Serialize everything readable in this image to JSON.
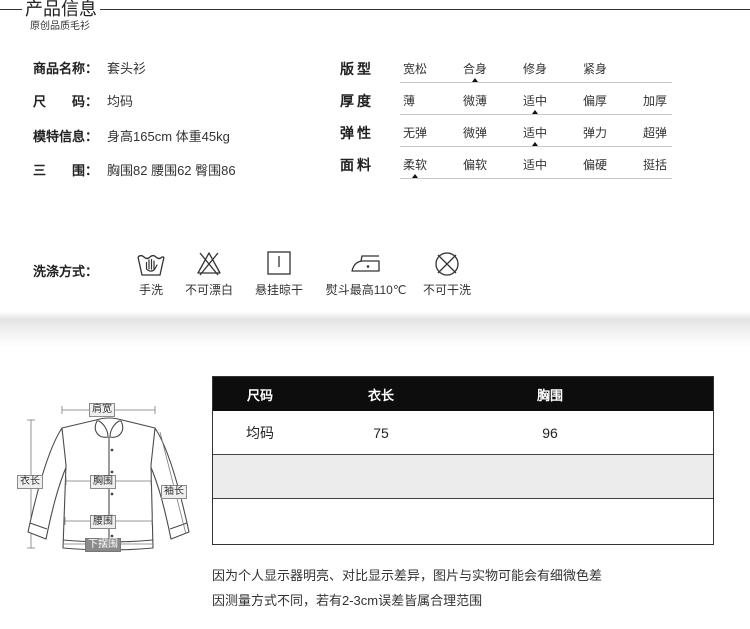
{
  "header": {
    "title": "产品信息",
    "subtitle": "原创品质毛衫"
  },
  "basic_info": [
    {
      "label": "商品名称：",
      "value": "套头衫"
    },
    {
      "label": "尺　　码：",
      "value": "均码"
    },
    {
      "label": "模特信息：",
      "value": "身高165cm 体重45kg"
    },
    {
      "label": "三　　围：",
      "value": "胸围82 腰围62 臀围86"
    }
  ],
  "specs": [
    {
      "label": "版型",
      "options": [
        "宽松",
        "合身",
        "修身",
        "紧身"
      ],
      "selected": 1
    },
    {
      "label": "厚度",
      "options": [
        "薄",
        "微薄",
        "适中",
        "偏厚",
        "加厚"
      ],
      "selected": 2
    },
    {
      "label": "弹性",
      "options": [
        "无弹",
        "微弹",
        "适中",
        "弹力",
        "超弹"
      ],
      "selected": 2
    },
    {
      "label": "面料",
      "options": [
        "柔软",
        "偏软",
        "适中",
        "偏硬",
        "挺括"
      ],
      "selected": 0
    }
  ],
  "washing": {
    "label": "洗涤方式：",
    "items": [
      {
        "icon": "hand-wash-icon",
        "text": "手洗"
      },
      {
        "icon": "no-bleach-icon",
        "text": "不可漂白"
      },
      {
        "icon": "hang-dry-icon",
        "text": "悬挂晾干"
      },
      {
        "icon": "iron-icon",
        "text": "熨斗最高110℃"
      },
      {
        "icon": "no-dry-clean-icon",
        "text": "不可干洗"
      }
    ]
  },
  "size_diagram": {
    "shoulder": "肩宽",
    "length": "衣长",
    "chest": "胸围",
    "sleeve": "袖长",
    "waist": "腰围",
    "hem": "下摆围"
  },
  "size_table": {
    "headers": [
      "尺码",
      "衣长",
      "胸围"
    ],
    "rows": [
      [
        "均码",
        "75",
        "96"
      ]
    ]
  },
  "notes": [
    "因为个人显示器明亮、对比显示差异，图片与实物可能会有细微色差",
    "因测量方式不同，若有2-3cm误差皆属合理范围"
  ],
  "colors": {
    "table_header_bg": "#0d0d0d",
    "table_header_text": "#ffffff",
    "stripe_row": "#ececec"
  }
}
